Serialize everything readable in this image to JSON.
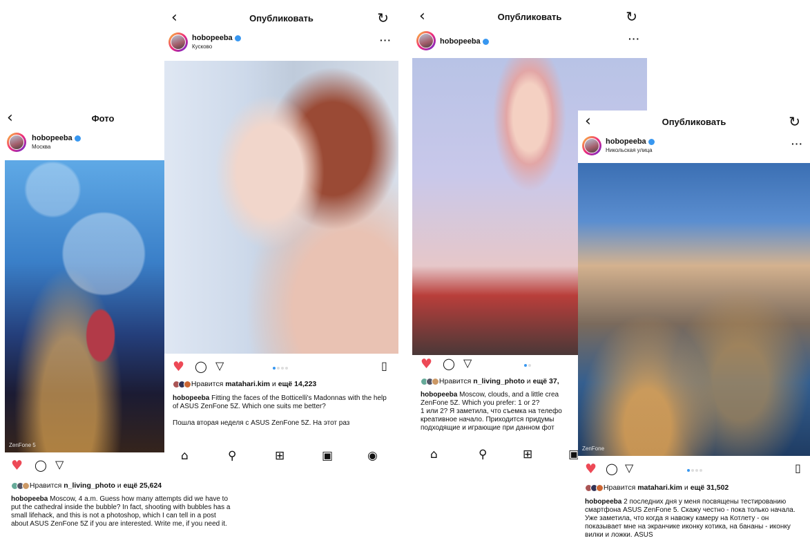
{
  "colors": {
    "accent": "#3897f0",
    "like": "#ed4956"
  },
  "screens": [
    {
      "title": "Фото",
      "username": "hobopeeba",
      "location": "Москва",
      "watermark": "ZenFone 5",
      "likes_prefix": "Нравится",
      "likes_user": "n_living_photo",
      "likes_mid": "и",
      "likes_count": "ещё 25,624",
      "caption_user": "hobopeeba",
      "caption_text": "Moscow, 4 a.m. Guess how many attempts did we have to put the cathedral inside the bubble? In fact, shooting with bubbles has a small lifehack, and this is not a photoshop, which I can tell in a post about ASUS ZenFone 5Z if you are interested. Write me, if you need it."
    },
    {
      "title": "Опубликовать",
      "username": "hobopeeba",
      "location": "Кусково",
      "carousel": {
        "current": 1,
        "total": 4
      },
      "likes_prefix": "Нравится",
      "likes_user": "matahari.kim",
      "likes_mid": "и",
      "likes_count": "ещё 14,223",
      "caption_user": "hobopeeba",
      "caption_text": "Fitting the faces of the Botticelli's Madonnas with the help of ASUS ZenFone 5Z. Which one suits me better?",
      "caption_more": "Пошла вторая неделя с ASUS ZenFone 5Z. На этот раз"
    },
    {
      "title": "Опубликовать",
      "username": "hobopeeba",
      "carousel": {
        "current": 1,
        "total": 2
      },
      "likes_prefix": "Нравится",
      "likes_user": "n_living_photo",
      "likes_mid": "и",
      "likes_count": "ещё 37,",
      "caption_user": "hobopeeba",
      "caption_text": "Moscow, clouds, and a little crea ZenFone 5Z. Which you prefer: 1 or 2?",
      "caption_more": "1 или 2? Я заметила, что съемка на телефо креативное начало. Приходится придумы подходящие и играющие при данном фот"
    },
    {
      "title": "Опубликовать",
      "username": "hobopeeba",
      "location": "Никольская улица",
      "watermark": "ZenFone",
      "carousel": {
        "current": 1,
        "total": 4
      },
      "likes_prefix": "Нравится",
      "likes_user": "matahari.kim",
      "likes_mid": "и",
      "likes_count": "ещё 31,502",
      "caption_user": "hobopeeba",
      "caption_text": "2 последних дня у меня посвящены тестированию смартфона ASUS ZenFone 5. Скажу честно - пока только начала. Уже заметила, что когда я навожу камеру на Котлету - он показывает мне на экранчике иконку котика, на бананы - иконку вилки и ложки. ASUS"
    }
  ]
}
